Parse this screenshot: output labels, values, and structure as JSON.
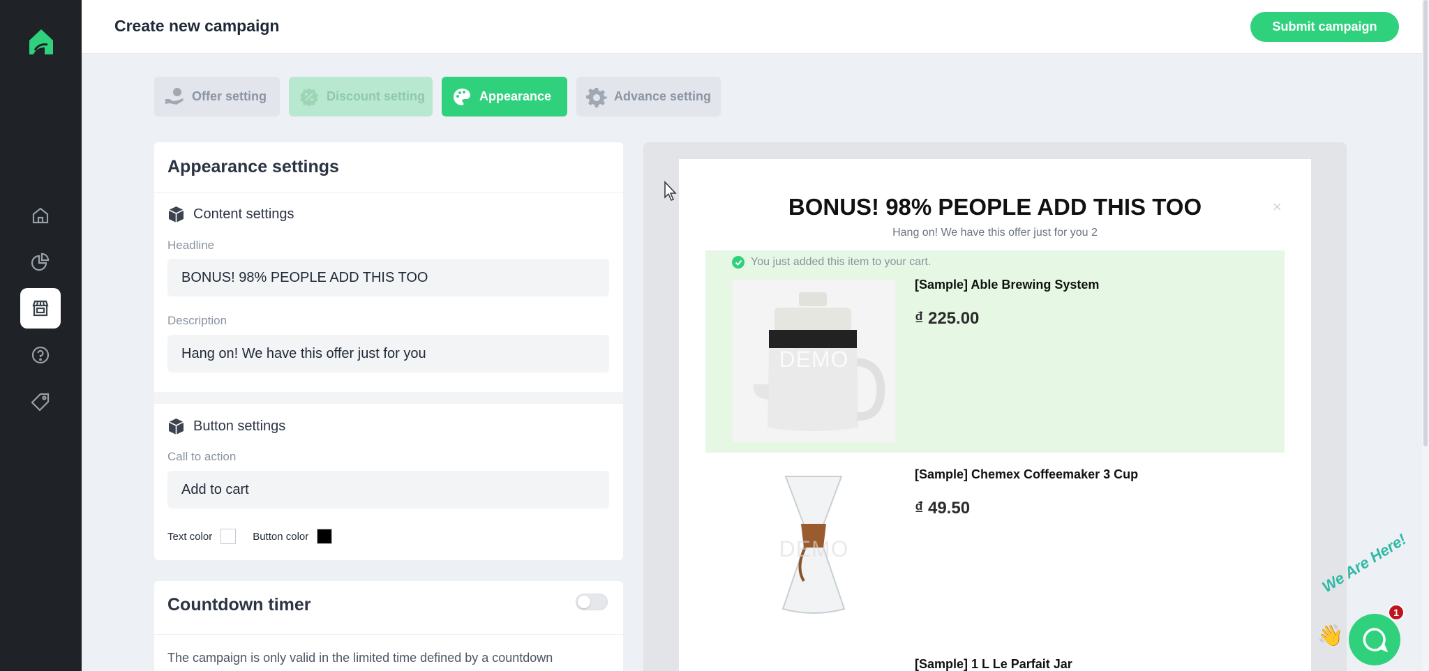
{
  "header": {
    "title": "Create new campaign",
    "submit_label": "Submit campaign"
  },
  "sidebar": {
    "items": [
      {
        "icon": "home-icon"
      },
      {
        "icon": "analytics-icon"
      },
      {
        "icon": "store-icon",
        "active": true
      },
      {
        "icon": "help-icon"
      },
      {
        "icon": "tag-icon"
      }
    ]
  },
  "tabs": [
    {
      "label": "Offer setting",
      "state": "inactive"
    },
    {
      "label": "Discount setting",
      "state": "done"
    },
    {
      "label": "Appearance",
      "state": "active"
    },
    {
      "label": "Advance setting",
      "state": "inactive"
    }
  ],
  "appearance": {
    "title": "Appearance settings",
    "content_settings": {
      "heading": "Content settings",
      "headline_label": "Headline",
      "headline_value": "BONUS! 98% PEOPLE ADD THIS TOO",
      "description_label": "Description",
      "description_value": "Hang on! We have this offer just for you"
    },
    "button_settings": {
      "heading": "Button settings",
      "cta_label": "Call to action",
      "cta_value": "Add to cart",
      "text_color_label": "Text color",
      "text_color": "#ffffff",
      "button_color_label": "Button color",
      "button_color": "#000000"
    }
  },
  "countdown": {
    "title": "Countdown timer",
    "enabled": false,
    "description": "The campaign is only valid in the limited time defined by a countdown"
  },
  "preview": {
    "title": "BONUS! 98% PEOPLE ADD THIS TOO",
    "subtitle": "Hang on! We have this offer just for you 2",
    "close": "×",
    "added_message": "You just added this item to your cart.",
    "watermark": "DEMO",
    "products": [
      {
        "name": "[Sample] Able Brewing System",
        "price": "₫ 225.00"
      },
      {
        "name": "[Sample] Chemex Coffeemaker 3 Cup",
        "price": "₫ 49.50"
      },
      {
        "name": "[Sample] 1 L Le Parfait Jar",
        "price": ""
      }
    ]
  },
  "chat": {
    "tagline": "We Are Here!",
    "badge_count": "1"
  },
  "colors": {
    "accent": "#2fd17d",
    "sidebar": "#1f2226",
    "added_band": "#e6f8e4"
  }
}
